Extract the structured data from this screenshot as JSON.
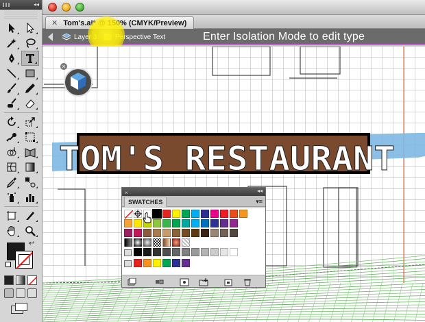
{
  "window": {
    "tab_title": "Tom's.ai* @ 150% (CMYK/Preview)",
    "tab_close_icon": "close-icon"
  },
  "isolation": {
    "crumbs": [
      {
        "label": "Layer 3",
        "icon": "layer-icon"
      },
      {
        "label": "Perspective Text",
        "icon": "group-icon"
      }
    ],
    "message": "Enter Isolation Mode to edit type"
  },
  "artwork": {
    "sign_text": "TOM'S RESTAURANT",
    "sign_color": "#7a4a2e",
    "highlight_color": "#f5ee00",
    "banner_color": "#7fb8e3",
    "grid_color": "#6a8fd8",
    "isolation_border_color": "#c65fd3"
  },
  "swatches_panel": {
    "tab_label": "SWATCHES",
    "menu_icon": "panel-menu-icon",
    "footer_buttons": [
      {
        "name": "swatch-libraries-menu-button",
        "icon": "libraries-icon"
      },
      {
        "name": "show-swatch-kinds-button",
        "icon": "kinds-icon"
      },
      {
        "name": "swatch-options-button",
        "icon": "options-icon"
      },
      {
        "name": "new-color-group-button",
        "icon": "new-group-icon"
      },
      {
        "name": "new-swatch-button",
        "icon": "new-swatch-icon"
      },
      {
        "name": "delete-swatch-button",
        "icon": "trash-icon"
      }
    ],
    "row1_colors": [
      "#ffffff",
      "#000000",
      "#ffffff",
      "#000000",
      "#e52421",
      "#fff100",
      "#00a651",
      "#00aeef",
      "#2e3192",
      "#ec008c",
      "#ee1c25",
      "#e94e1b",
      "#f7941d"
    ],
    "row2_colors": [
      "#f7a234",
      "#ffe600",
      "#c4d600",
      "#8dc63f",
      "#39b54a",
      "#00a651",
      "#00a99d",
      "#00aeef",
      "#0072bc",
      "#2e3192",
      "#662d91",
      "#92278f"
    ],
    "row3_colors": [
      "#9e1f63",
      "#c2185b",
      "#8e5a3c",
      "#a97c50",
      "#c69c6d",
      "#8c6239",
      "#754c24",
      "#603913",
      "#3c2415",
      "#998675",
      "#736357",
      "#534741"
    ],
    "gradient_row": [
      "#111111",
      "#777777",
      "#9a9a9a",
      "#d9d9d9",
      "#c8a27a",
      "#b03a2e",
      "#e8e8e8"
    ],
    "gray_row": [
      "#000000",
      "#1a1a1a",
      "#333333",
      "#4d4d4d",
      "#666666",
      "#808080",
      "#999999",
      "#b3b3b3",
      "#cccccc",
      "#e6e6e6",
      "#ffffff"
    ],
    "group_row": [
      "#e52421",
      "#f7941d",
      "#fff100",
      "#00a651",
      "#2e3192",
      "#662d91"
    ]
  },
  "toolbar": {
    "fill_color": "#1a1a1a",
    "tools": [
      "selection-tool",
      "direct-selection-tool",
      "magic-wand-tool",
      "lasso-tool",
      "pen-tool",
      "type-tool",
      "line-segment-tool",
      "rectangle-tool",
      "paintbrush-tool",
      "pencil-tool",
      "blob-brush-tool",
      "eraser-tool",
      "rotate-tool",
      "scale-tool",
      "warp-tool",
      "free-transform-tool",
      "shape-builder-tool",
      "perspective-grid-tool",
      "mesh-tool",
      "gradient-tool",
      "eyedropper-tool",
      "blend-tool",
      "symbol-sprayer-tool",
      "column-graph-tool",
      "artboard-tool",
      "slice-tool",
      "hand-tool",
      "zoom-tool"
    ]
  }
}
